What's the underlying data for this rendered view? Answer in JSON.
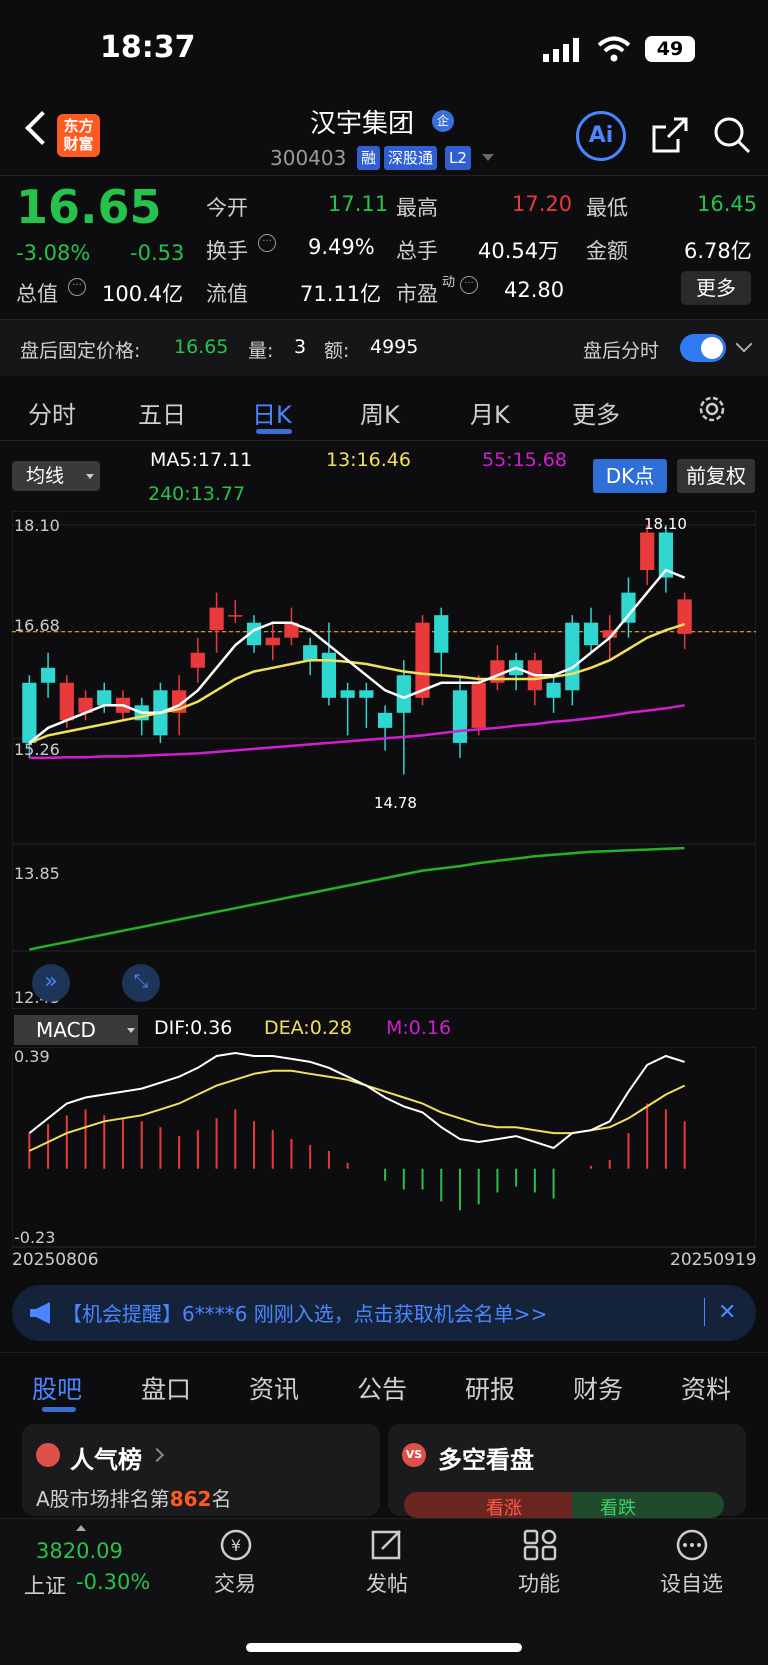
{
  "status": {
    "time": "18:37",
    "battery": "49"
  },
  "header": {
    "logo": "东方财富",
    "stock_name": "汉宇集团",
    "enterprise_badge": "企",
    "stock_code": "300403",
    "tags": [
      "融",
      "深股通",
      "L2"
    ],
    "ai_label": "Ai"
  },
  "quote": {
    "price": "16.65",
    "change_pct": "-3.08%",
    "change": "-0.53",
    "cap_label": "总值",
    "cap_value": "100.4亿",
    "open_label": "今开",
    "open_value": "17.11",
    "turnover_label": "换手",
    "turnover_value": "9.49%",
    "float_label": "流值",
    "float_value": "71.11亿",
    "high_label": "最高",
    "high_value": "17.20",
    "volume_label": "总手",
    "volume_value": "40.54万",
    "pe_label": "市盈",
    "pe_sup": "动",
    "pe_value": "42.80",
    "low_label": "最低",
    "low_value": "16.45",
    "amount_label": "金额",
    "amount_value": "6.78亿",
    "more_label": "更多"
  },
  "after_hours": {
    "price_label": "盘后固定价格:",
    "price": "16.65",
    "qty_label": "量:",
    "qty": "3",
    "amt_label": "额:",
    "amt": "4995",
    "timeshare_label": "盘后分时"
  },
  "period_tabs": [
    "分时",
    "五日",
    "日K",
    "周K",
    "月K",
    "更多"
  ],
  "active_period": "日K",
  "ma_bar": {
    "select": "均线",
    "ma5": "MA5:17.11",
    "ma13": "13:16.46",
    "ma55": "55:15.68",
    "ma240": "240:13.77",
    "dk_label": "DK点",
    "adjust_label": "前复权"
  },
  "colors": {
    "up": "#e83a3a",
    "down": "#2fd7d0",
    "ma5": "#ffffff",
    "ma13": "#f2e05a",
    "ma55": "#d21ed2",
    "ma240": "#27b027",
    "accent": "#4a86ff"
  },
  "chart_data": {
    "type": "candlestick",
    "price_axis": {
      "labels": [
        "18.10",
        "16.68",
        "15.26",
        "13.85",
        "12.43"
      ],
      "ylim": [
        12.43,
        18.1
      ]
    },
    "reference_line": 16.68,
    "annotations": {
      "high": "18.10",
      "low": "14.78"
    },
    "x_start": "20250806",
    "x_end": "20250919",
    "candles": [
      {
        "o": 16.0,
        "c": 15.2,
        "h": 16.1,
        "l": 15.0
      },
      {
        "o": 16.2,
        "c": 16.0,
        "h": 16.4,
        "l": 15.8
      },
      {
        "o": 15.5,
        "c": 16.0,
        "h": 16.1,
        "l": 15.4
      },
      {
        "o": 15.6,
        "c": 15.8,
        "h": 15.9,
        "l": 15.5
      },
      {
        "o": 15.9,
        "c": 15.7,
        "h": 16.0,
        "l": 15.6
      },
      {
        "o": 15.6,
        "c": 15.8,
        "h": 15.9,
        "l": 15.5
      },
      {
        "o": 15.7,
        "c": 15.5,
        "h": 15.8,
        "l": 15.3
      },
      {
        "o": 15.9,
        "c": 15.3,
        "h": 16.0,
        "l": 15.2
      },
      {
        "o": 15.6,
        "c": 15.9,
        "h": 16.1,
        "l": 15.3
      },
      {
        "o": 16.2,
        "c": 16.4,
        "h": 16.6,
        "l": 16.0
      },
      {
        "o": 16.7,
        "c": 17.0,
        "h": 17.2,
        "l": 16.4
      },
      {
        "o": 16.9,
        "c": 16.9,
        "h": 17.1,
        "l": 16.8
      },
      {
        "o": 16.8,
        "c": 16.5,
        "h": 16.9,
        "l": 16.4
      },
      {
        "o": 16.5,
        "c": 16.6,
        "h": 16.8,
        "l": 16.3
      },
      {
        "o": 16.6,
        "c": 16.8,
        "h": 17.0,
        "l": 16.5
      },
      {
        "o": 16.5,
        "c": 16.3,
        "h": 16.6,
        "l": 16.1
      },
      {
        "o": 16.4,
        "c": 15.8,
        "h": 16.8,
        "l": 15.7
      },
      {
        "o": 15.9,
        "c": 15.8,
        "h": 16.0,
        "l": 15.3
      },
      {
        "o": 15.9,
        "c": 15.8,
        "h": 16.0,
        "l": 15.4
      },
      {
        "o": 15.6,
        "c": 15.4,
        "h": 15.7,
        "l": 15.1
      },
      {
        "o": 16.1,
        "c": 15.6,
        "h": 16.3,
        "l": 14.78
      },
      {
        "o": 15.8,
        "c": 16.8,
        "h": 16.9,
        "l": 15.7
      },
      {
        "o": 16.9,
        "c": 16.4,
        "h": 17.0,
        "l": 16.1
      },
      {
        "o": 15.9,
        "c": 15.2,
        "h": 16.1,
        "l": 15.0
      },
      {
        "o": 15.4,
        "c": 16.0,
        "h": 16.1,
        "l": 15.3
      },
      {
        "o": 16.0,
        "c": 16.3,
        "h": 16.5,
        "l": 15.9
      },
      {
        "o": 16.3,
        "c": 16.1,
        "h": 16.4,
        "l": 15.9
      },
      {
        "o": 15.9,
        "c": 16.3,
        "h": 16.4,
        "l": 15.7
      },
      {
        "o": 16.0,
        "c": 15.8,
        "h": 16.1,
        "l": 15.6
      },
      {
        "o": 16.8,
        "c": 15.9,
        "h": 16.9,
        "l": 15.7
      },
      {
        "o": 16.8,
        "c": 16.5,
        "h": 17.0,
        "l": 16.4
      },
      {
        "o": 16.6,
        "c": 16.7,
        "h": 16.9,
        "l": 16.3
      },
      {
        "o": 17.2,
        "c": 16.8,
        "h": 17.4,
        "l": 16.6
      },
      {
        "o": 17.5,
        "c": 18.0,
        "h": 18.1,
        "l": 17.3
      },
      {
        "o": 18.0,
        "c": 17.4,
        "h": 18.1,
        "l": 17.2
      },
      {
        "o": 16.65,
        "c": 17.11,
        "h": 17.2,
        "l": 16.45
      }
    ],
    "ma5": [
      15.2,
      15.4,
      15.5,
      15.6,
      15.7,
      15.7,
      15.6,
      15.6,
      15.7,
      15.9,
      16.2,
      16.5,
      16.7,
      16.8,
      16.8,
      16.7,
      16.5,
      16.3,
      16.1,
      15.9,
      15.8,
      15.9,
      16.0,
      16.0,
      16.0,
      16.1,
      16.2,
      16.1,
      16.1,
      16.2,
      16.4,
      16.6,
      16.9,
      17.2,
      17.5,
      17.4
    ],
    "ma13": [
      15.2,
      15.3,
      15.35,
      15.4,
      15.45,
      15.5,
      15.55,
      15.6,
      15.65,
      15.75,
      15.9,
      16.05,
      16.15,
      16.2,
      16.25,
      16.3,
      16.3,
      16.28,
      16.25,
      16.2,
      16.15,
      16.12,
      16.1,
      16.08,
      16.05,
      16.05,
      16.05,
      16.05,
      16.08,
      16.12,
      16.2,
      16.3,
      16.45,
      16.6,
      16.7,
      16.78
    ],
    "ma55": [
      15.0,
      15.0,
      15.01,
      15.01,
      15.02,
      15.02,
      15.03,
      15.04,
      15.05,
      15.06,
      15.08,
      15.1,
      15.12,
      15.14,
      15.16,
      15.18,
      15.2,
      15.22,
      15.24,
      15.26,
      15.28,
      15.3,
      15.33,
      15.36,
      15.38,
      15.4,
      15.43,
      15.45,
      15.48,
      15.5,
      15.53,
      15.56,
      15.6,
      15.63,
      15.66,
      15.7
    ],
    "ma240": [
      12.45,
      12.5,
      12.55,
      12.6,
      12.65,
      12.7,
      12.75,
      12.8,
      12.85,
      12.9,
      12.95,
      13.0,
      13.05,
      13.1,
      13.15,
      13.2,
      13.25,
      13.3,
      13.35,
      13.4,
      13.45,
      13.5,
      13.53,
      13.56,
      13.6,
      13.63,
      13.66,
      13.69,
      13.71,
      13.73,
      13.75,
      13.76,
      13.77,
      13.78,
      13.79,
      13.8
    ],
    "macd": {
      "select": "MACD",
      "dif_label": "DIF:0.36",
      "dea_label": "DEA:0.28",
      "m_label": "M:0.16",
      "axis": [
        "0.39",
        "-0.23"
      ],
      "ylim": [
        -0.23,
        0.39
      ],
      "dif": [
        0.12,
        0.17,
        0.22,
        0.24,
        0.25,
        0.26,
        0.27,
        0.29,
        0.31,
        0.34,
        0.38,
        0.39,
        0.38,
        0.38,
        0.37,
        0.36,
        0.34,
        0.31,
        0.28,
        0.24,
        0.21,
        0.19,
        0.14,
        0.1,
        0.09,
        0.1,
        0.11,
        0.09,
        0.07,
        0.12,
        0.13,
        0.16,
        0.26,
        0.35,
        0.38,
        0.36
      ],
      "dea": [
        0.06,
        0.09,
        0.12,
        0.14,
        0.16,
        0.17,
        0.18,
        0.2,
        0.22,
        0.25,
        0.28,
        0.3,
        0.32,
        0.33,
        0.33,
        0.32,
        0.31,
        0.3,
        0.28,
        0.26,
        0.24,
        0.22,
        0.19,
        0.17,
        0.15,
        0.14,
        0.14,
        0.13,
        0.12,
        0.12,
        0.13,
        0.14,
        0.17,
        0.21,
        0.25,
        0.28
      ],
      "m": [
        0.12,
        0.15,
        0.18,
        0.2,
        0.18,
        0.17,
        0.16,
        0.14,
        0.11,
        0.13,
        0.17,
        0.2,
        0.16,
        0.13,
        0.1,
        0.08,
        0.06,
        0.02,
        0.0,
        -0.04,
        -0.07,
        -0.07,
        -0.11,
        -0.14,
        -0.12,
        -0.08,
        -0.06,
        -0.08,
        -0.1,
        0.0,
        0.01,
        0.03,
        0.12,
        0.22,
        0.2,
        0.16
      ]
    }
  },
  "notice": {
    "text": "【机会提醒】6****6 刚刚入选，点击获取机会名单>>"
  },
  "bottom_tabs": [
    "股吧",
    "盘口",
    "资讯",
    "公告",
    "研报",
    "财务",
    "资料"
  ],
  "cards": {
    "hot_title": "人气榜",
    "hot_rank_prefix": "A股市场排名第",
    "hot_rank": "862",
    "hot_rank_suffix": "名",
    "vs_title": "多空看盘",
    "bull_label": "看涨",
    "bear_label": "看跌"
  },
  "nav": {
    "index_value": "3820.09",
    "index_name": "上证",
    "index_change": "-0.30%",
    "items": [
      "交易",
      "发帖",
      "功能",
      "设自选"
    ]
  }
}
